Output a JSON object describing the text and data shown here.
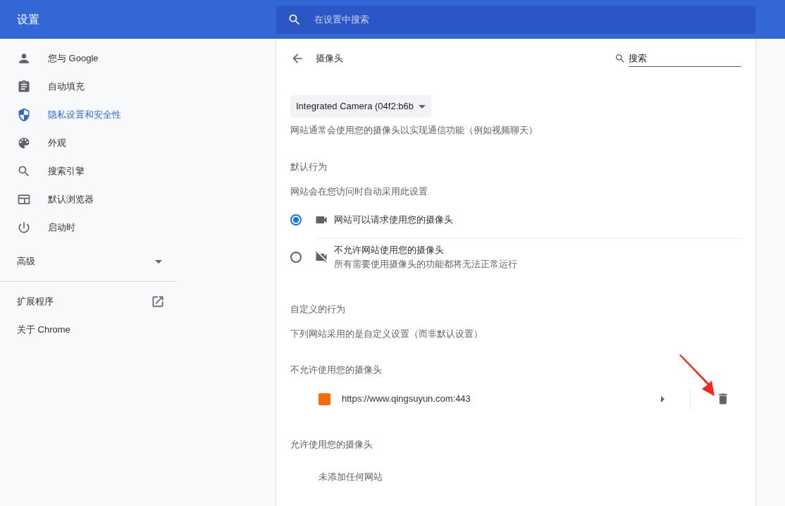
{
  "header": {
    "title": "设置",
    "search": {
      "placeholder": "在设置中搜索"
    }
  },
  "sidebar": {
    "items": [
      {
        "kind": "person",
        "label": "您与 Google",
        "selected": false
      },
      {
        "kind": "autofill",
        "label": "自动填充",
        "selected": false
      },
      {
        "kind": "privacy",
        "label": "隐私设置和安全性",
        "selected": true
      },
      {
        "kind": "appearance",
        "label": "外观",
        "selected": false
      },
      {
        "kind": "search",
        "label": "搜索引擎",
        "selected": false
      },
      {
        "kind": "browser",
        "label": "默认浏览器",
        "selected": false
      },
      {
        "kind": "startup",
        "label": "启动时",
        "selected": false
      }
    ],
    "advanced": {
      "label": "高级",
      "expanded": false
    },
    "links": [
      {
        "label": "扩展程序",
        "external": true
      },
      {
        "label": "关于 Chrome",
        "external": false
      }
    ]
  },
  "page": {
    "title": "摄像头",
    "search": {
      "placeholder": "搜索"
    },
    "device": {
      "value": "Integrated Camera (04f2:b6b"
    },
    "description": "网站通常会使用您的摄像头以实现通信功能（例如视频聊天）",
    "default_behavior": {
      "heading": "默认行为",
      "subtitle": "网站会在您访问时自动采用此设置",
      "options": [
        {
          "kind": "allow",
          "label": "网站可以请求使用您的摄像头",
          "selected": true
        },
        {
          "kind": "block",
          "label": "不允许网站使用您的摄像头",
          "description": "所有需要使用摄像头的功能都将无法正常运行",
          "selected": false
        }
      ]
    },
    "custom_behavior": {
      "heading": "自定义的行为",
      "subtitle": "下列网站采用的是自定义设置（而非默认设置）"
    },
    "blocked": {
      "heading": "不允许使用您的摄像头",
      "sites": [
        {
          "url": "https://www.qingsuyun.com:443"
        }
      ]
    },
    "allowed": {
      "heading": "允许使用您的摄像头",
      "empty": "未添加任何网站"
    }
  }
}
